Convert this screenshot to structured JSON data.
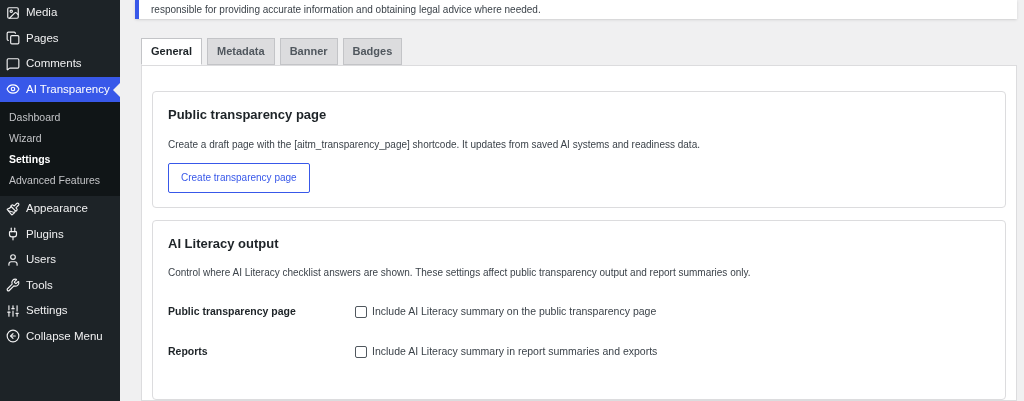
{
  "sidebar": {
    "items": [
      {
        "kind": "media",
        "label": "Media",
        "selected": false
      },
      {
        "kind": "pages",
        "label": "Pages",
        "selected": false
      },
      {
        "kind": "comments",
        "label": "Comments",
        "selected": false
      },
      {
        "kind": "eye",
        "label": "AI Transparency",
        "selected": true,
        "children": [
          {
            "label": "Dashboard",
            "selected": false
          },
          {
            "label": "Wizard",
            "selected": false
          },
          {
            "label": "Settings",
            "selected": true
          },
          {
            "label": "Advanced Features",
            "selected": false
          }
        ]
      },
      {
        "kind": "appearance",
        "label": "Appearance",
        "selected": false
      },
      {
        "kind": "plugins",
        "label": "Plugins",
        "selected": false
      },
      {
        "kind": "users",
        "label": "Users",
        "selected": false
      },
      {
        "kind": "tools",
        "label": "Tools",
        "selected": false
      },
      {
        "kind": "settings",
        "label": "Settings",
        "selected": false
      },
      {
        "kind": "collapse",
        "label": "Collapse Menu",
        "selected": false
      }
    ]
  },
  "notice": {
    "text": "responsible for providing accurate information and obtaining legal advice where needed."
  },
  "tabs": [
    {
      "label": "General",
      "selected": true
    },
    {
      "label": "Metadata",
      "selected": false
    },
    {
      "label": "Banner",
      "selected": false
    },
    {
      "label": "Badges",
      "selected": false
    }
  ],
  "cards": [
    {
      "title": "Public transparency page",
      "description": "Create a draft page with the [aitm_transparency_page] shortcode. It updates from saved AI systems and readiness data.",
      "button": "Create transparency page"
    },
    {
      "title": "AI Literacy output",
      "description": "Control where AI Literacy checklist answers are shown. These settings affect public transparency output and report summaries only.",
      "options": [
        {
          "label": "Public transparency page",
          "text": "Include AI Literacy summary on the public transparency page",
          "checked": false
        },
        {
          "label": "Reports",
          "text": "Include AI Literacy summary in report summaries and exports",
          "checked": false
        }
      ]
    }
  ]
}
